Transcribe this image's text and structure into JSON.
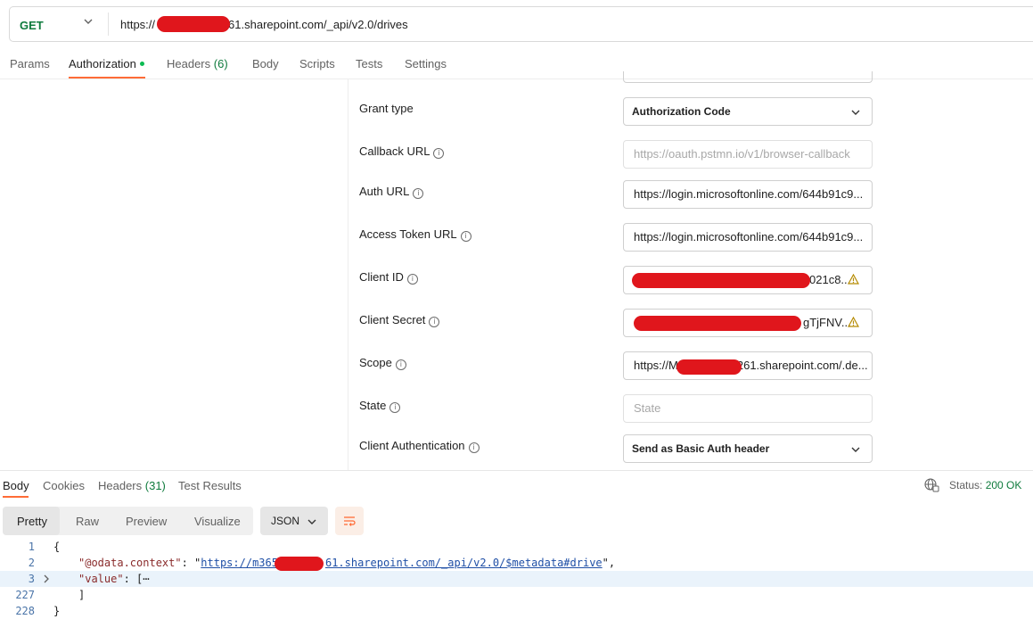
{
  "request": {
    "method": "GET",
    "url_prefix": "https://",
    "url_suffix": "61.sharepoint.com/_api/v2.0/drives"
  },
  "tabs": [
    {
      "label": "Params"
    },
    {
      "label": "Authorization"
    },
    {
      "label": "Headers",
      "count": "(6)"
    },
    {
      "label": "Body"
    },
    {
      "label": "Scripts"
    },
    {
      "label": "Tests"
    },
    {
      "label": "Settings"
    }
  ],
  "auth": {
    "grant_type": {
      "label": "Grant type",
      "value": "Authorization Code"
    },
    "callback_url": {
      "label": "Callback URL",
      "placeholder": "https://oauth.pstmn.io/v1/browser-callback"
    },
    "auth_url": {
      "label": "Auth URL",
      "value": "https://login.microsoftonline.com/644b91c9..."
    },
    "access_token_url": {
      "label": "Access Token URL",
      "value": "https://login.microsoftonline.com/644b91c9..."
    },
    "client_id": {
      "label": "Client ID",
      "value": "021c8..."
    },
    "client_secret": {
      "label": "Client Secret",
      "value": "gTjFNV..."
    },
    "scope": {
      "label": "Scope",
      "value_prefix": "https://M",
      "value_suffix": "261.sharepoint.com/.de..."
    },
    "state": {
      "label": "State",
      "placeholder": "State"
    },
    "client_auth": {
      "label": "Client Authentication",
      "value": "Send as Basic Auth header"
    }
  },
  "response": {
    "tabs": [
      {
        "label": "Body"
      },
      {
        "label": "Cookies"
      },
      {
        "label": "Headers",
        "count": "(31)"
      },
      {
        "label": "Test Results"
      }
    ],
    "status_label": "Status:",
    "status_value": "200 OK",
    "view_modes": [
      "Pretty",
      "Raw",
      "Preview",
      "Visualize"
    ],
    "format": "JSON",
    "lines": [
      {
        "num": "1",
        "text": "{"
      },
      {
        "num": "2",
        "key": "\"@odata.context\"",
        "sep": ": ",
        "link_prefix": "https://m365",
        "link_suffix": "61.sharepoint.com/_api/v2.0/$metadata#drive",
        "tail": "\","
      },
      {
        "num": "3",
        "key": "\"value\"",
        "rest": ": [⋯"
      },
      {
        "num": "227",
        "text": "]"
      },
      {
        "num": "228",
        "text": "}"
      }
    ]
  },
  "colors": {
    "accent": "#ff6c37",
    "get": "#0f7b3d",
    "redaction": "#e0161c"
  }
}
